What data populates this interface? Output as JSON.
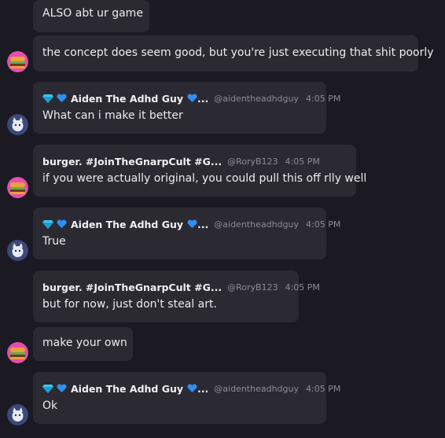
{
  "messages": [
    {
      "text": "ALSO abt ur game"
    },
    {
      "avatar": "burger-avatar",
      "text": "the concept does seem good, but you're just executing that shit poorly"
    },
    {
      "avatar": "cat-avatar",
      "name": "Aiden The Adhd Guy",
      "handle": "@aidentheadhdguy",
      "time": "4:05 PM",
      "text": "What can i make it better"
    },
    {
      "avatar": "burger-avatar",
      "name": "burger. #JoinTheGnarpCult #G...",
      "handle": "@RoryB123",
      "time": "4:05 PM",
      "text": "if you were actually original, you could pull this off rlly well"
    },
    {
      "avatar": "cat-avatar",
      "name": "Aiden The Adhd Guy",
      "handle": "@aidentheadhdguy",
      "time": "4:05 PM",
      "text": "True"
    },
    {
      "name": "burger. #JoinTheGnarpCult #G...",
      "handle": "@RoryB123",
      "time": "4:05 PM",
      "text": "but for now, just don't steal art."
    },
    {
      "avatar": "burger-avatar",
      "text": "make your own"
    },
    {
      "avatar": "cat-avatar",
      "name": "Aiden The Adhd Guy",
      "handle": "@aidentheadhdguy",
      "time": "4:05 PM",
      "text": "Ok"
    }
  ],
  "colors": {
    "background": "#1b1a22",
    "bubble": "#2b2a33",
    "muted": "#8d8a96",
    "gem": "#39c4f0",
    "heart": "#2f8ff0"
  },
  "icons": {
    "gem": "gem-icon",
    "heart": "blue-heart-icon",
    "ellipsis": "..."
  }
}
